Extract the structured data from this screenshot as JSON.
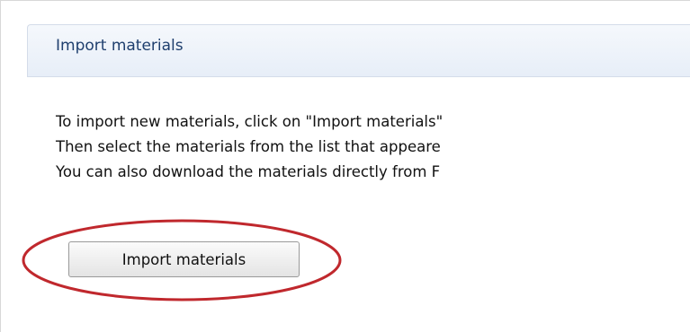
{
  "panel": {
    "title": "Import materials"
  },
  "instructions": {
    "line1": "To import new materials, click on \"Import materials\"",
    "line2": "Then select the materials from the list that appeare",
    "line3": "You can also download the materials directly from F"
  },
  "actions": {
    "import_button_label": "Import materials"
  },
  "colors": {
    "annotation_oval": "#c0282d",
    "header_text": "#1f3f6e"
  }
}
